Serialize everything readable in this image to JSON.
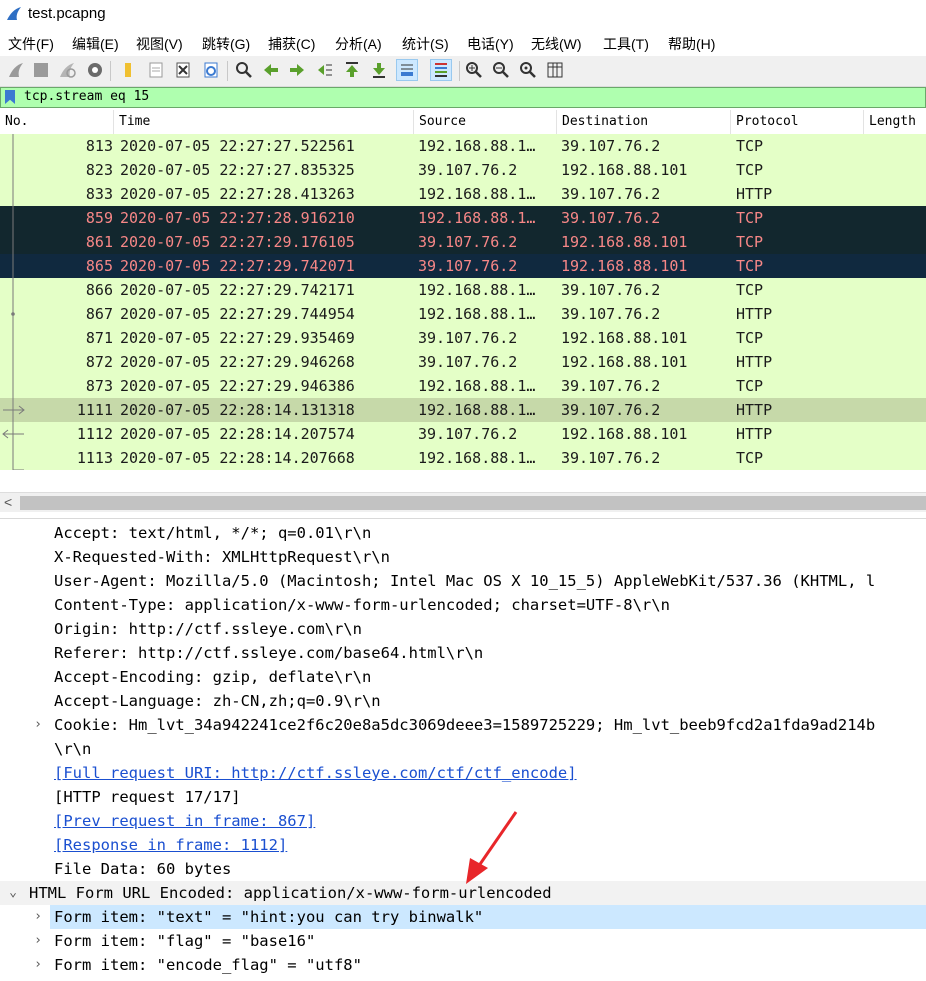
{
  "window": {
    "title": "test.pcapng"
  },
  "menu": [
    "文件(F)",
    "编辑(E)",
    "视图(V)",
    "跳转(G)",
    "捕获(C)",
    "分析(A)",
    "统计(S)",
    "电话(Y)",
    "无线(W)",
    "工具(T)",
    "帮助(H)"
  ],
  "toolbar": {
    "icons": [
      "shark-fin-start-icon",
      "stop-capture-icon",
      "restart-capture-icon",
      "capture-options-icon",
      "open-file-icon",
      "save-file-icon",
      "close-file-icon",
      "reload-file-icon",
      "find-packet-icon",
      "go-back-icon",
      "go-forward-icon",
      "go-to-packet-icon",
      "go-first-icon",
      "go-last-icon",
      "autoscroll-icon",
      "colorize-icon",
      "zoom-in-icon",
      "zoom-out-icon",
      "zoom-normal-icon",
      "resize-columns-icon"
    ]
  },
  "filter": {
    "value": "tcp.stream eq 15"
  },
  "packet_list": {
    "columns": [
      "No.",
      "Time",
      "Source",
      "Destination",
      "Protocol",
      "Length"
    ],
    "rows": [
      {
        "no": "813",
        "time": "2020-07-05 22:27:27.522561",
        "src": "192.168.88.1…",
        "dst": "39.107.76.2",
        "proto": "TCP",
        "style": "green"
      },
      {
        "no": "823",
        "time": "2020-07-05 22:27:27.835325",
        "src": "39.107.76.2",
        "dst": "192.168.88.101",
        "proto": "TCP",
        "style": "green"
      },
      {
        "no": "833",
        "time": "2020-07-05 22:27:28.413263",
        "src": "192.168.88.1…",
        "dst": "39.107.76.2",
        "proto": "HTTP",
        "style": "green"
      },
      {
        "no": "859",
        "time": "2020-07-05 22:27:28.916210",
        "src": "192.168.88.1…",
        "dst": "39.107.76.2",
        "proto": "TCP",
        "style": "black"
      },
      {
        "no": "861",
        "time": "2020-07-05 22:27:29.176105",
        "src": "39.107.76.2",
        "dst": "192.168.88.101",
        "proto": "TCP",
        "style": "black"
      },
      {
        "no": "865",
        "time": "2020-07-05 22:27:29.742071",
        "src": "39.107.76.2",
        "dst": "192.168.88.101",
        "proto": "TCP",
        "style": "navy"
      },
      {
        "no": "866",
        "time": "2020-07-05 22:27:29.742171",
        "src": "192.168.88.1…",
        "dst": "39.107.76.2",
        "proto": "TCP",
        "style": "green"
      },
      {
        "no": "867",
        "time": "2020-07-05 22:27:29.744954",
        "src": "192.168.88.1…",
        "dst": "39.107.76.2",
        "proto": "HTTP",
        "style": "green"
      },
      {
        "no": "871",
        "time": "2020-07-05 22:27:29.935469",
        "src": "39.107.76.2",
        "dst": "192.168.88.101",
        "proto": "TCP",
        "style": "green"
      },
      {
        "no": "872",
        "time": "2020-07-05 22:27:29.946268",
        "src": "39.107.76.2",
        "dst": "192.168.88.101",
        "proto": "HTTP",
        "style": "green"
      },
      {
        "no": "873",
        "time": "2020-07-05 22:27:29.946386",
        "src": "192.168.88.1…",
        "dst": "39.107.76.2",
        "proto": "TCP",
        "style": "green"
      },
      {
        "no": "1111",
        "time": "2020-07-05 22:28:14.131318",
        "src": "192.168.88.1…",
        "dst": "39.107.76.2",
        "proto": "HTTP",
        "style": "selected"
      },
      {
        "no": "1112",
        "time": "2020-07-05 22:28:14.207574",
        "src": "39.107.76.2",
        "dst": "192.168.88.101",
        "proto": "HTTP",
        "style": "green"
      },
      {
        "no": "1113",
        "time": "2020-07-05 22:28:14.207668",
        "src": "192.168.88.1…",
        "dst": "39.107.76.2",
        "proto": "TCP",
        "style": "green"
      }
    ]
  },
  "details": {
    "lines": [
      {
        "text": "Accept: text/html, */*; q=0.01\\r\\n",
        "expander": "",
        "link": false
      },
      {
        "text": "X-Requested-With: XMLHttpRequest\\r\\n",
        "expander": "",
        "link": false
      },
      {
        "text": "User-Agent: Mozilla/5.0 (Macintosh; Intel Mac OS X 10_15_5) AppleWebKit/537.36 (KHTML, l",
        "expander": "",
        "link": false
      },
      {
        "text": "Content-Type: application/x-www-form-urlencoded; charset=UTF-8\\r\\n",
        "expander": "",
        "link": false
      },
      {
        "text": "Origin: http://ctf.ssleye.com\\r\\n",
        "expander": "",
        "link": false
      },
      {
        "text": "Referer: http://ctf.ssleye.com/base64.html\\r\\n",
        "expander": "",
        "link": false
      },
      {
        "text": "Accept-Encoding: gzip, deflate\\r\\n",
        "expander": "",
        "link": false
      },
      {
        "text": "Accept-Language: zh-CN,zh;q=0.9\\r\\n",
        "expander": "",
        "link": false
      },
      {
        "text": "Cookie: Hm_lvt_34a942241ce2f6c20e8a5dc3069deee3=1589725229; Hm_lvt_beeb9fcd2a1fda9ad214b",
        "expander": ">",
        "link": false
      },
      {
        "text": "\\r\\n",
        "expander": "",
        "link": false
      },
      {
        "text": "[Full request URI: http://ctf.ssleye.com/ctf/ctf_encode]",
        "expander": "",
        "link": true
      },
      {
        "text": "[HTTP request 17/17]",
        "expander": "",
        "link": false
      },
      {
        "text": "[Prev request in frame: 867]",
        "expander": "",
        "link": true
      },
      {
        "text": "[Response in frame: 1112]",
        "expander": "",
        "link": true
      },
      {
        "text": "File Data: 60 bytes",
        "expander": "",
        "link": false
      }
    ],
    "form_header": {
      "text": "HTML Form URL Encoded: application/x-www-form-urlencoded",
      "expander": "v"
    },
    "form_items": [
      {
        "text": "Form item: \"text\" = \"hint:you can try binwalk\"",
        "expander": ">"
      },
      {
        "text": "Form item: \"flag\" = \"base16\"",
        "expander": ">"
      },
      {
        "text": "Form item: \"encode_flag\" = \"utf8\"",
        "expander": ">"
      }
    ]
  },
  "colors": {
    "green": "#e4ffc7",
    "black": "#12272e",
    "navy": "#10293f",
    "selected": "#c6d9a9",
    "red_text": "#f78787",
    "annotation_arrow": "#e8262a",
    "filter_bg": "#afffaf"
  }
}
